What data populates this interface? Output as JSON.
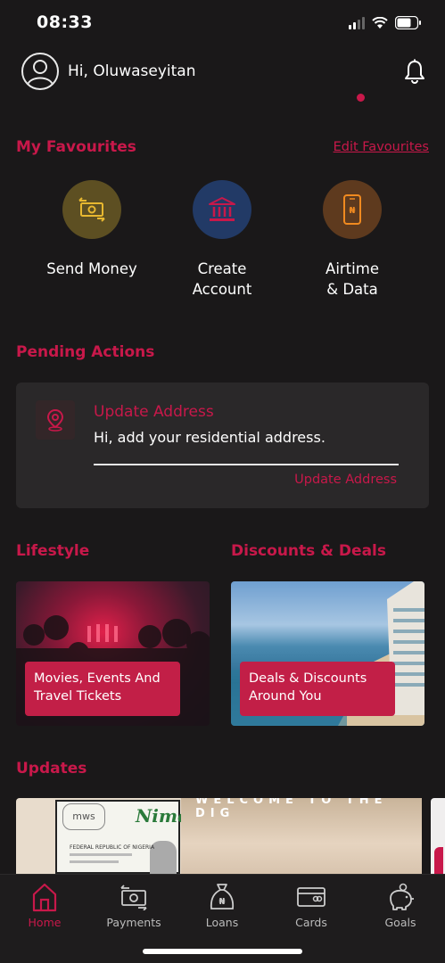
{
  "status_bar": {
    "time": "08:33"
  },
  "header": {
    "greeting": "Hi, Oluwaseyitan"
  },
  "favourites": {
    "title": "My Favourites",
    "edit_label": "Edit Favourites",
    "items": [
      {
        "label_line1": "Send Money",
        "label_line2": "",
        "color": "#5d4f22",
        "icon": "money-transfer-icon"
      },
      {
        "label_line1": "Create",
        "label_line2": "Account",
        "color": "#223a66",
        "icon": "bank-icon"
      },
      {
        "label_line1": "Airtime",
        "label_line2": "& Data",
        "color": "#5e3a1e",
        "icon": "phone-naira-icon"
      }
    ]
  },
  "pending": {
    "title": "Pending Actions",
    "card": {
      "title": "Update Address",
      "description": "Hi, add your residential address.",
      "link": "Update Address"
    }
  },
  "lifestyle": {
    "title": "Lifestyle",
    "card_label": "Movies, Events And Travel Tickets"
  },
  "deals": {
    "title": "Discounts & Deals",
    "card_label": "Deals & Discounts Around You"
  },
  "updates": {
    "title": "Updates",
    "banner1_text1": "mws",
    "banner1_text2": "Nimc",
    "banner1_text3": "FEDERAL REPUBLIC OF NIGERIA",
    "banner2_text": "WELCOME TO THE DIG"
  },
  "bottom_nav": [
    {
      "label": "Home",
      "icon": "home-icon",
      "active": true
    },
    {
      "label": "Payments",
      "icon": "payments-icon",
      "active": false
    },
    {
      "label": "Loans",
      "icon": "loans-icon",
      "active": false
    },
    {
      "label": "Cards",
      "icon": "cards-icon",
      "active": false
    },
    {
      "label": "Goals",
      "icon": "goals-icon",
      "active": false
    }
  ],
  "colors": {
    "accent": "#c8184a",
    "background": "#1a1819",
    "card": "#2a2829"
  }
}
